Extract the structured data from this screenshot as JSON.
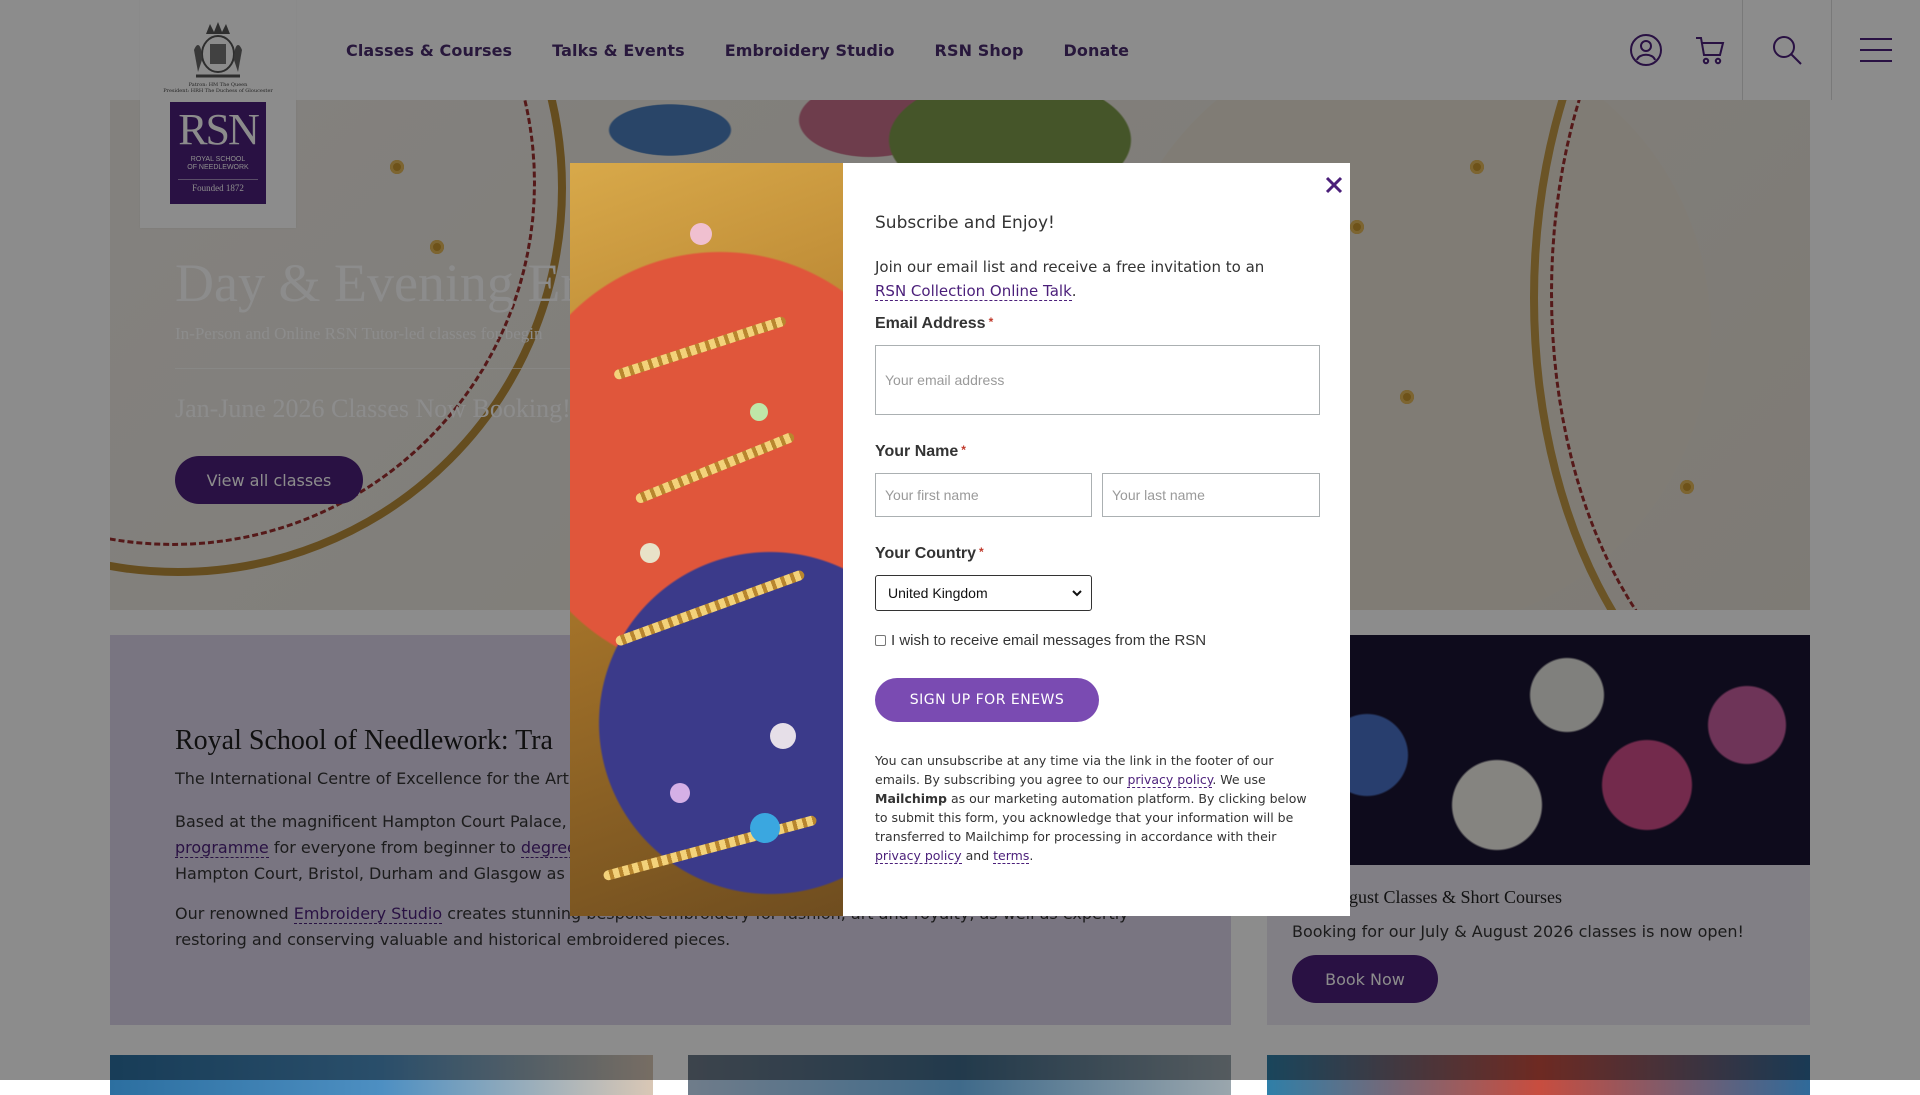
{
  "header": {
    "nav": [
      {
        "label": "Classes & Courses"
      },
      {
        "label": "Talks & Events"
      },
      {
        "label": "Embroidery Studio"
      },
      {
        "label": "RSN Shop"
      },
      {
        "label": "Donate"
      }
    ],
    "icons": [
      "account-icon",
      "cart-icon",
      "search-icon",
      "menu-icon"
    ]
  },
  "logo": {
    "patron_line1": "Patron: HM The Queen",
    "patron_line2": "President: HRH The Duchess of Gloucester",
    "letters": "RSN",
    "name_line1": "ROYAL SCHOOL",
    "name_line2": "OF NEEDLEWORK",
    "founded": "Founded 1872"
  },
  "hero": {
    "title": "Day & Evening Er",
    "subtitle": "In-Person and Online RSN Tutor-led classes for begin",
    "booking": "Jan-June 2026 Classes Now Booking!",
    "button": "View all classes"
  },
  "about": {
    "title": "Royal School of Needlework: Tra",
    "lead": "The International Centre of Excellence for the Art",
    "p1_start": "Based at the magnificent Hampton Court Palace,",
    "p1_link1": "programme",
    "p1_mid": " for everyone from beginner to ",
    "p1_link2": "degree",
    "p1_end": "Hampton Court, Bristol, Durham and Glasgow as w",
    "p2_start": "Our renowned ",
    "p2_link": "Embroidery Studio",
    "p2_end": " creates stunning bespoke embroidery for fashion, art and royalty, as well as expertly restoring and conserving valuable and historical embroidered pieces."
  },
  "summer": {
    "title": "July/August Classes & Short Courses",
    "text": "Booking for our July & August 2026 classes is now open!",
    "button": "Book Now"
  },
  "modal": {
    "close": "✕",
    "title": "Subscribe and Enjoy!",
    "intro": "Join our email list and receive a free invitation to an",
    "intro_link": "RSN Collection Online Talk",
    "intro_end": ".",
    "email_label": "Email Address",
    "email_placeholder": "Your email address",
    "name_label": "Your Name",
    "first_placeholder": "Your first name",
    "last_placeholder": "Your last name",
    "country_label": "Your Country",
    "country_value": "United Kingdom",
    "required_mark": "*",
    "checkbox_label": "I wish to receive email messages from the RSN",
    "submit": "SIGN UP FOR ENEWS",
    "legal_1": "You can unsubscribe at any time via the link in the footer of our emails. By subscribing you agree to our ",
    "legal_link1": "privacy policy",
    "legal_2": ". We use ",
    "legal_bold": "Mailchimp",
    "legal_3": " as our marketing automation platform. By clicking below to submit this form, you acknowledge that your information will be transferred to Mailchimp for processing in accordance with their ",
    "legal_link2": "privacy policy",
    "legal_4": " and ",
    "legal_link3": "terms",
    "legal_5": "."
  },
  "colors": {
    "brand_purple": "#4b1f7a",
    "button_purple": "#7a4bb2",
    "about_bg": "#ddd6ec",
    "required": "#c0392b"
  }
}
